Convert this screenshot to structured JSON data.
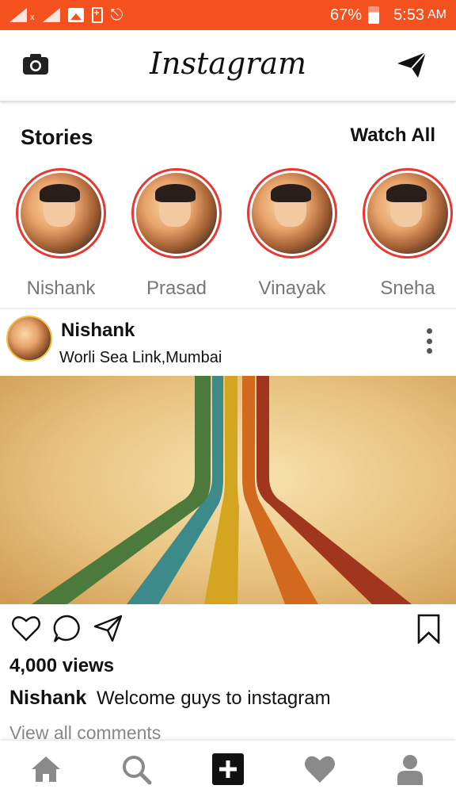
{
  "status_bar": {
    "battery": "67%",
    "time": "5:53",
    "ampm": "AM"
  },
  "app_bar": {
    "title": "Instagram"
  },
  "stories": {
    "title": "Stories",
    "watch_all": "Watch All",
    "items": [
      {
        "name": "Nishank"
      },
      {
        "name": "Prasad"
      },
      {
        "name": "Vinayak"
      },
      {
        "name": "Sneha"
      }
    ]
  },
  "post": {
    "username": "Nishank",
    "location": "Worli Sea Link,Mumbai",
    "views": "4,000 views",
    "caption_user": "Nishank",
    "caption_text": "Welcome guys to instagram",
    "view_comments": "View all comments"
  },
  "colors": {
    "status_bar": "#f4511e",
    "story_ring": "#e53935",
    "nav_icon": "#8a8a8a"
  }
}
